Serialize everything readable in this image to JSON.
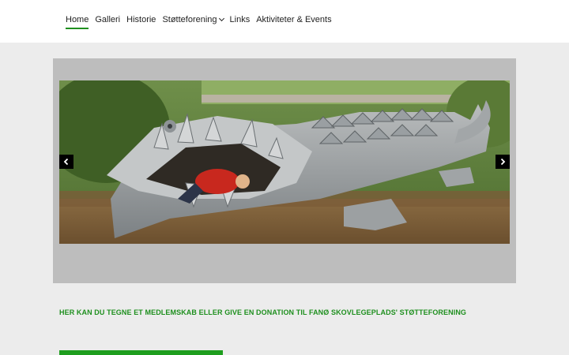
{
  "nav": {
    "items": [
      {
        "label": "Home",
        "active": true
      },
      {
        "label": "Galleri"
      },
      {
        "label": "Historie"
      },
      {
        "label": "Støtteforening",
        "dropdown": true
      },
      {
        "label": "Links"
      },
      {
        "label": "Aktiviteter & Events"
      }
    ]
  },
  "slider": {
    "image_subject": "carved wooden dragon sculpture with child in mouth",
    "prev_icon": "chevron-left-icon",
    "next_icon": "chevron-right-icon"
  },
  "cta": {
    "text": "HER KAN DU TEGNE ET MEDLEMSKAB ELLER GIVE EN DONATION TIL FANØ SKOVLEGEPLADS' STØTTEFORENING"
  },
  "colors": {
    "accent": "#1e8f1e",
    "background": "#ececec",
    "slider_panel": "#bdbdbd",
    "header": "#ffffff"
  }
}
